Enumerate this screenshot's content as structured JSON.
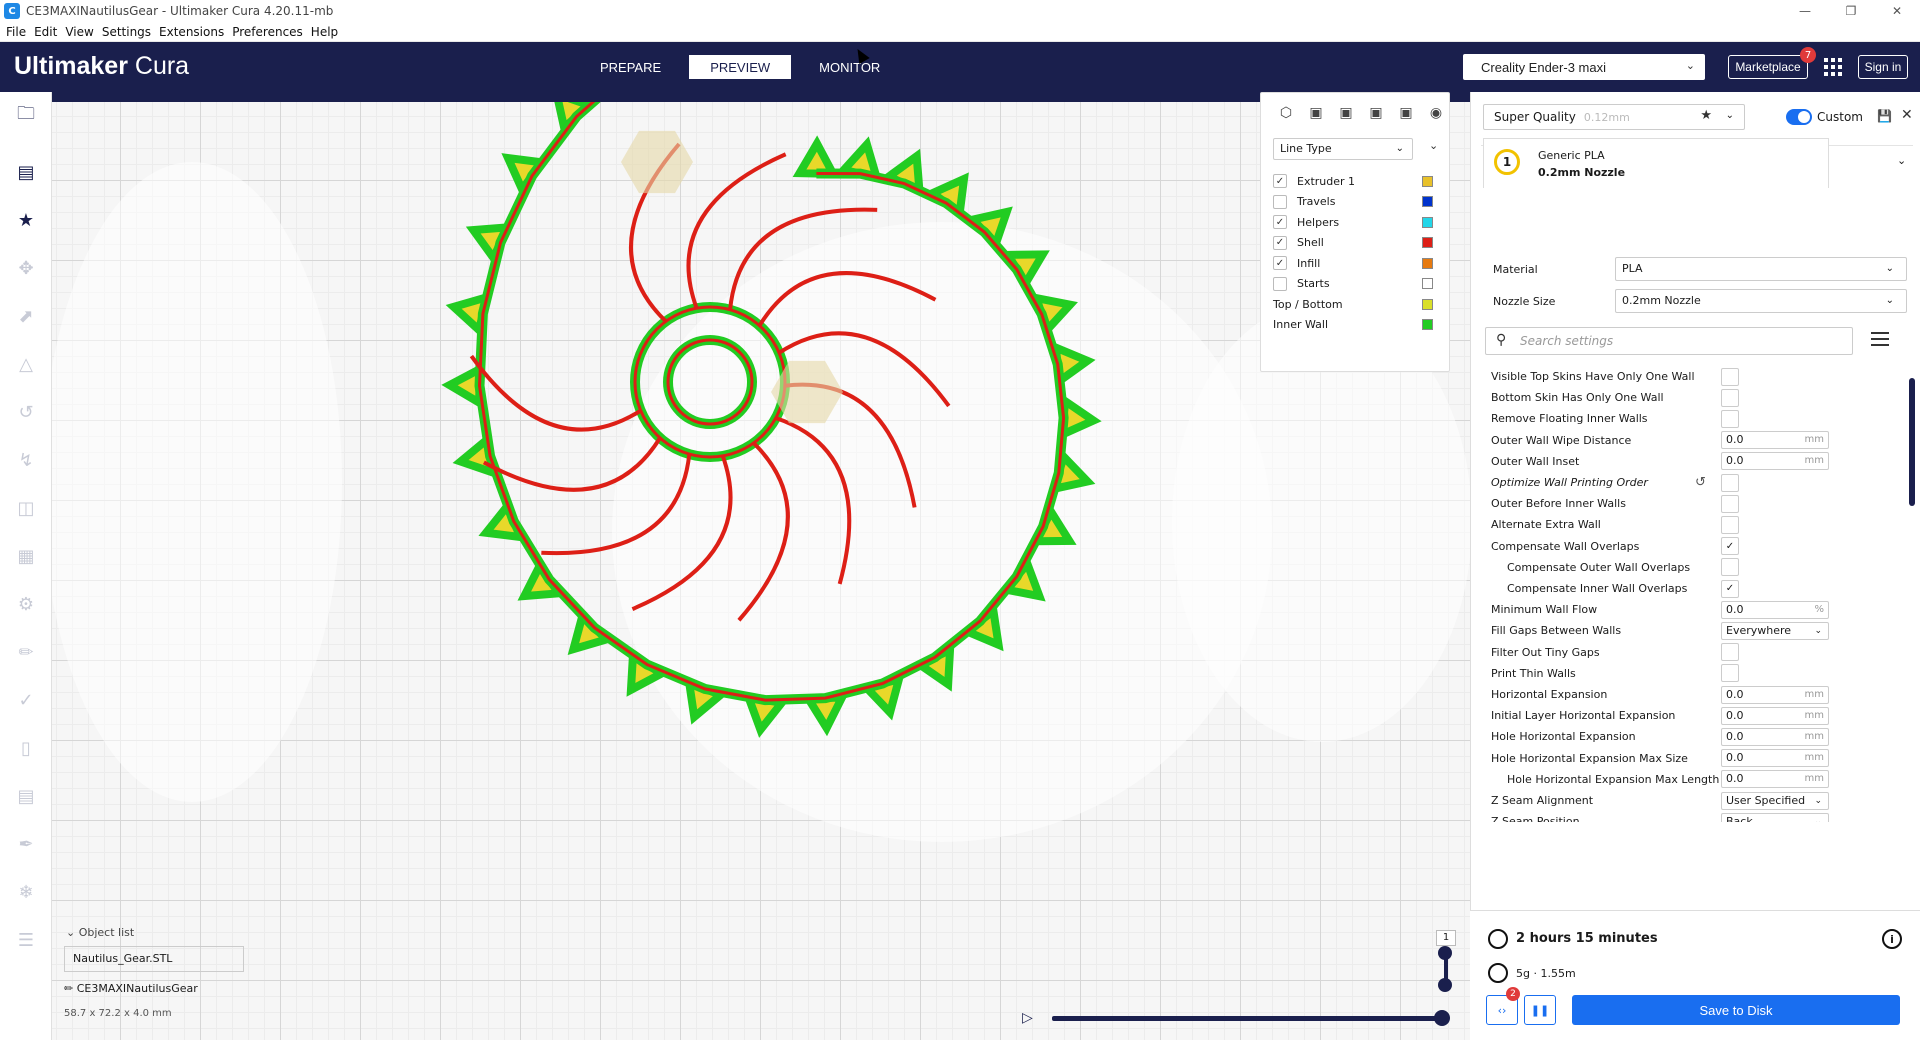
{
  "window": {
    "title": "CE3MAXINautilusGear - Ultimaker Cura 4.20.11-mb",
    "app_icon": "C"
  },
  "menu": [
    "File",
    "Edit",
    "View",
    "Settings",
    "Extensions",
    "Preferences",
    "Help"
  ],
  "header": {
    "logo_bold": "Ultimaker",
    "logo_light": " Cura",
    "stages": [
      "PREPARE",
      "PREVIEW",
      "MONITOR"
    ],
    "active_stage": "PREVIEW",
    "printer": "Creality Ender-3 maxi",
    "marketplace_label": "Marketplace",
    "marketplace_badge": "7",
    "signin_label": "Sign in",
    "bg_color": "#1a1f4d"
  },
  "toolbar_icons": [
    "folder-icon",
    "object-list-icon",
    "star-icon",
    "move-icon",
    "scale-icon",
    "mirror-icon",
    "undo-icon",
    "rotate-z-icon",
    "spacing-icon",
    "arrange-icon",
    "support-icon",
    "measure-icon",
    "paint-icon",
    "cylinder-icon",
    "split-icon",
    "knife-icon",
    "snowflake-icon",
    "slice-icon"
  ],
  "color_scheme": {
    "mode": "Line Type",
    "items": [
      {
        "label": "Extruder 1",
        "checked": true,
        "color": "#e8c12a",
        "has_checkbox": true
      },
      {
        "label": "Travels",
        "checked": false,
        "color": "#0033cc",
        "has_checkbox": true
      },
      {
        "label": "Helpers",
        "checked": true,
        "color": "#22d6e8",
        "has_checkbox": true
      },
      {
        "label": "Shell",
        "checked": true,
        "color": "#dd1f16",
        "has_checkbox": true
      },
      {
        "label": "Infill",
        "checked": true,
        "color": "#e67a10",
        "has_checkbox": true
      },
      {
        "label": "Starts",
        "checked": false,
        "color": "#ffffff",
        "has_checkbox": true
      },
      {
        "label": "Top / Bottom",
        "checked": false,
        "color": "#d9e02a",
        "has_checkbox": false
      },
      {
        "label": "Inner Wall",
        "checked": false,
        "color": "#22cc22",
        "has_checkbox": false
      }
    ]
  },
  "print_settings": {
    "quality": "Super Quality",
    "quality_sub": "0.12mm",
    "custom_label": "Custom",
    "extruder_number": "1",
    "material_name": "Generic PLA",
    "nozzle_name": "0.2mm Nozzle",
    "material_label": "Material",
    "material_value": "PLA",
    "nozzle_label": "Nozzle Size",
    "nozzle_value": "0.2mm Nozzle",
    "search_placeholder": "Search settings",
    "settings": [
      {
        "label": "Visible Top Skins Have Only One Wall",
        "type": "check",
        "checked": false
      },
      {
        "label": "Bottom Skin Has Only One Wall",
        "type": "check",
        "checked": false
      },
      {
        "label": "Remove Floating Inner Walls",
        "type": "check",
        "checked": false
      },
      {
        "label": "Outer Wall Wipe Distance",
        "type": "input",
        "value": "0.0",
        "unit": "mm"
      },
      {
        "label": "Outer Wall Inset",
        "type": "input",
        "value": "0.0",
        "unit": "mm"
      },
      {
        "label": "Optimize Wall Printing Order",
        "type": "check",
        "checked": false,
        "italic": true,
        "reset": true
      },
      {
        "label": "Outer Before Inner Walls",
        "type": "check",
        "checked": false
      },
      {
        "label": "Alternate Extra Wall",
        "type": "check",
        "checked": false
      },
      {
        "label": "Compensate Wall Overlaps",
        "type": "check",
        "checked": true
      },
      {
        "label": "Compensate Outer Wall Overlaps",
        "type": "check",
        "checked": false,
        "indent": true
      },
      {
        "label": "Compensate Inner Wall Overlaps",
        "type": "check",
        "checked": true,
        "indent": true
      },
      {
        "label": "Minimum Wall Flow",
        "type": "input",
        "value": "0.0",
        "unit": "%"
      },
      {
        "label": "Fill Gaps Between Walls",
        "type": "select",
        "value": "Everywhere"
      },
      {
        "label": "Filter Out Tiny Gaps",
        "type": "check",
        "checked": false
      },
      {
        "label": "Print Thin Walls",
        "type": "check",
        "checked": false
      },
      {
        "label": "Horizontal Expansion",
        "type": "input",
        "value": "0.0",
        "unit": "mm"
      },
      {
        "label": "Initial Layer Horizontal Expansion",
        "type": "input",
        "value": "0.0",
        "unit": "mm"
      },
      {
        "label": "Hole Horizontal Expansion",
        "type": "input",
        "value": "0.0",
        "unit": "mm"
      },
      {
        "label": "Hole Horizontal Expansion Max Size",
        "type": "input",
        "value": "0.0",
        "unit": "mm"
      },
      {
        "label": "Hole Horizontal Expansion Max Length",
        "type": "input",
        "value": "0.0",
        "unit": "mm",
        "indent": true
      },
      {
        "label": "Z Seam Alignment",
        "type": "select",
        "value": "User Specified"
      },
      {
        "label": "Z Seam Position",
        "type": "select",
        "value": "Back"
      }
    ]
  },
  "estimate": {
    "time": "2 hours 15 minutes",
    "material": "5g · 1.55m",
    "badge": "2",
    "save_label": "Save to Disk",
    "info_glyph": "i"
  },
  "object_list": {
    "header": "Object list",
    "file": "Nautilus_Gear.STL",
    "printer": "CE3MAXINautilusGear",
    "dims": "58.7 x 72.2 x 4.0 mm"
  },
  "layer_slider": {
    "value": "1"
  },
  "model_colors": {
    "shell": "#dd1f16",
    "inner_wall": "#22cc22",
    "top_bottom": "#e8d82a",
    "helper": "#e6d8a8"
  }
}
